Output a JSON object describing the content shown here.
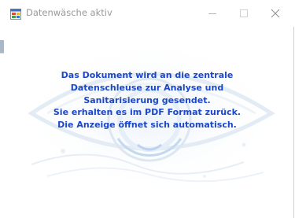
{
  "window": {
    "title": "Datenwäsche aktiv",
    "app_icon": "windows-form-icon",
    "controls": {
      "minimize_icon": "minimize-icon",
      "maximize_icon": "maximize-icon",
      "close_icon": "close-icon"
    }
  },
  "message": {
    "lines": [
      "Das Dokument wird an die zentrale",
      "Datenschleuse zur Analyse und",
      "Sanitarisierung gesendet.",
      "Sie erhalten es im PDF Format zurück.",
      "Die Anzeige öffnet sich automatisch."
    ]
  },
  "colors": {
    "message_text": "#1b47c9",
    "title_text": "#999999",
    "watermark": "#dbe6f2"
  }
}
